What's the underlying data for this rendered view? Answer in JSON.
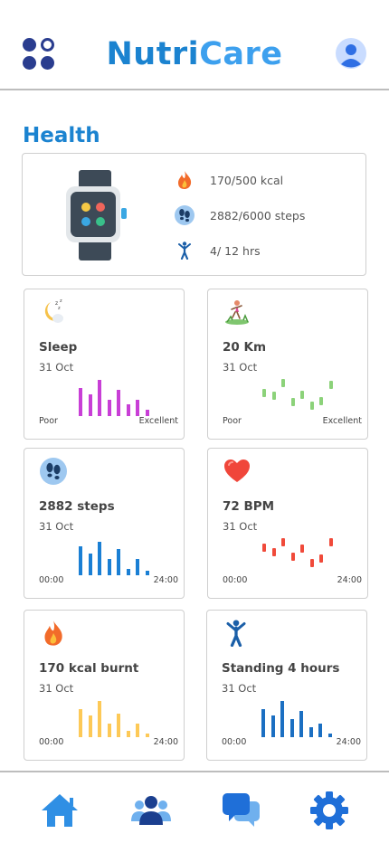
{
  "app": {
    "brand_part1": "Nutri",
    "brand_part2": "Care",
    "menu_icon": "apps-grid-icon",
    "profile_icon": "user-avatar-icon"
  },
  "section_title": "Health",
  "summary": {
    "device_icon": "smartwatch-icon",
    "stats": [
      {
        "icon": "fire-icon",
        "text": "170/500 kcal"
      },
      {
        "icon": "footsteps-icon",
        "text": "2882/6000 steps"
      },
      {
        "icon": "standing-person-icon",
        "text": "4/ 12 hrs"
      }
    ]
  },
  "cards": [
    {
      "id": "sleep",
      "icon": "moon-sleep-icon",
      "title": "Sleep",
      "date": "31 Oct",
      "left_label": "Poor",
      "right_label": "Excellent",
      "color": "#c83fd6",
      "style": "bars",
      "values": [
        0.7,
        0.55,
        0.9,
        0.4,
        0.65,
        0.3,
        0.4,
        0.15
      ]
    },
    {
      "id": "distance",
      "icon": "runner-icon",
      "title": "20 Km",
      "date": "31 Oct",
      "left_label": "Poor",
      "right_label": "Excellent",
      "color": "#8cd27a",
      "style": "segments",
      "values": [
        0.6,
        0.5,
        0.9,
        0.3,
        0.55,
        0.2,
        0.35,
        0.85
      ]
    },
    {
      "id": "steps",
      "icon": "footsteps-icon",
      "title": "2882 steps",
      "date": "31 Oct",
      "left_label": "00:00",
      "right_label": "24:00",
      "color": "#1a7fd4",
      "style": "bars",
      "values": [
        0.72,
        0.55,
        0.85,
        0.4,
        0.65,
        0.15,
        0.4,
        0.12
      ]
    },
    {
      "id": "heart",
      "icon": "heart-icon",
      "title": "72 BPM",
      "date": "31 Oct",
      "left_label": "00:00",
      "right_label": "24:00",
      "color": "#f04a3a",
      "style": "segments",
      "values": [
        0.75,
        0.6,
        0.9,
        0.45,
        0.7,
        0.25,
        0.4,
        0.9
      ]
    },
    {
      "id": "calories",
      "icon": "fire-icon",
      "title": "170 kcal burnt",
      "date": "31 Oct",
      "left_label": "00:00",
      "right_label": "24:00",
      "color": "#fdc957",
      "style": "bars",
      "values": [
        0.7,
        0.55,
        0.9,
        0.35,
        0.6,
        0.15,
        0.35,
        0.1
      ]
    },
    {
      "id": "standing",
      "icon": "standing-person-icon",
      "title": "Standing 4 hours",
      "date": "31 Oct",
      "left_label": "00:00",
      "right_label": "24:00",
      "color": "#1b6fc2",
      "style": "bars",
      "values": [
        0.7,
        0.55,
        0.9,
        0.45,
        0.65,
        0.25,
        0.35,
        0.1
      ]
    }
  ],
  "nav": [
    {
      "icon": "home-icon"
    },
    {
      "icon": "community-icon"
    },
    {
      "icon": "chat-icon"
    },
    {
      "icon": "settings-gear-icon"
    }
  ]
}
